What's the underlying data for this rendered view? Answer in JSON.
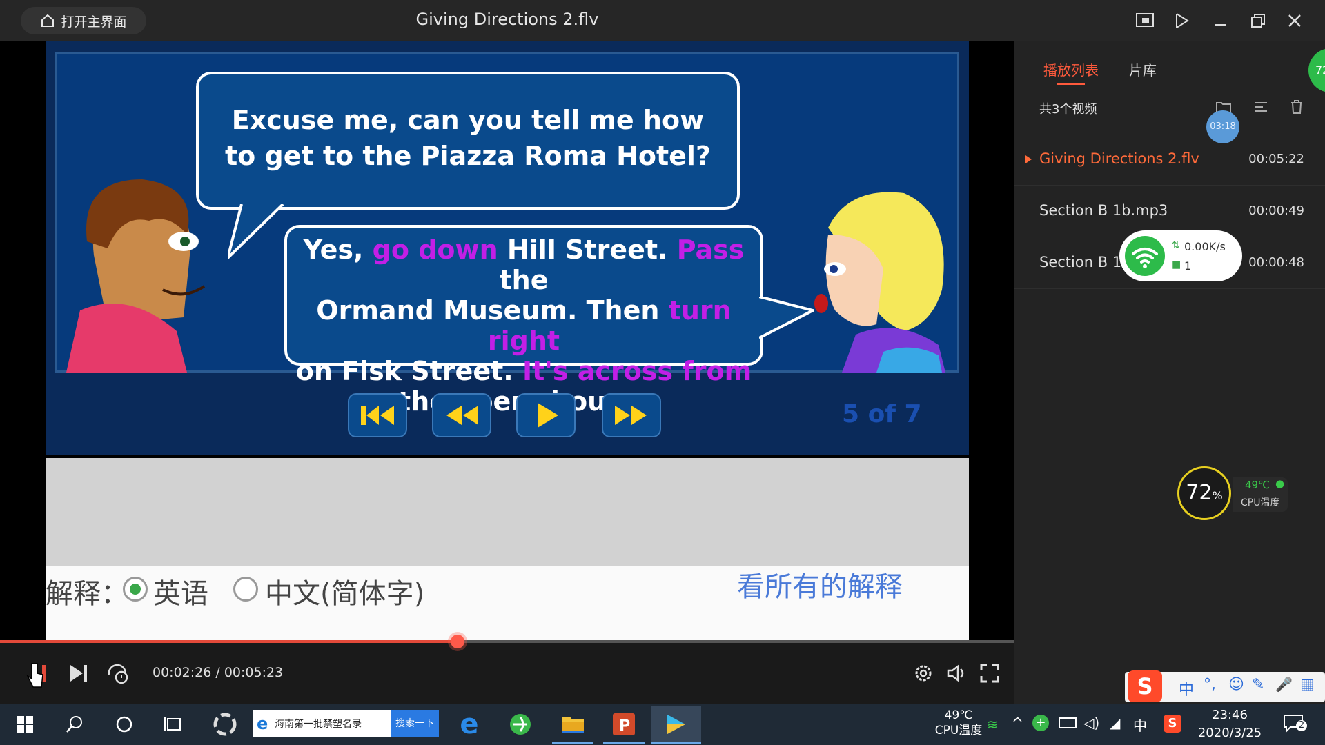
{
  "window": {
    "title": "Giving Directions 2.flv",
    "home_button": "打开主界面"
  },
  "video": {
    "bubble1_line1": "Excuse me, can you tell me how",
    "bubble1_line2": "to get to the Piazza Roma Hotel?",
    "b2_yes": "Yes,",
    "b2_go_down": "go down",
    "b2_hill": "Hill Street.",
    "b2_pass": "Pass",
    "b2_the": "the",
    "b2_ormand": "Ormand Museum. Then",
    "b2_turn_right": "turn right",
    "b2_on_fisk": "on Fisk Street.",
    "b2_across": "It's across from",
    "b2_opera": "the opera house.",
    "slide_counter": "5 of 7",
    "explain_label": "解释：",
    "option_english": "英语",
    "option_chinese": "中文(简体字)",
    "see_all": "看所有的解释"
  },
  "player": {
    "time_display": "00:02:26 / 00:05:23",
    "progress_fraction": 0.451
  },
  "sidebar": {
    "tabs": [
      "播放列表",
      "片库"
    ],
    "active_tab": "播放列表",
    "count_label": "共3个视频",
    "bubble_time": "03:18",
    "top_badge": "72",
    "playlist": [
      {
        "name": "Giving Directions 2.flv",
        "duration": "00:05:22",
        "active": true
      },
      {
        "name": "Section B 1b.mp3",
        "duration": "00:00:49",
        "active": false
      },
      {
        "name": "Section B 1",
        "duration": "00:00:48",
        "active": false
      }
    ]
  },
  "net_widget": {
    "speed": "0.00K/s",
    "count": "1"
  },
  "cpu_widget": {
    "percent": "72",
    "percent_unit": "%",
    "temp": "49℃",
    "label": "CPU温度"
  },
  "ime_bar": {
    "items": [
      "中",
      "°,",
      "☺",
      "✎",
      "🎤",
      "▦"
    ]
  },
  "taskbar": {
    "search_text": "海南第一批禁塑名录",
    "search_button": "搜索一下",
    "cpu_temp": "49℃",
    "cpu_label": "CPU温度",
    "ime": "中",
    "time": "23:46",
    "date": "2020/3/25",
    "notification_count": "2"
  },
  "colors": {
    "accent": "#ff5a3c",
    "active_item": "#ff6a3a",
    "highlight_text": "#c21fe6",
    "slide_bg": "#063a7c"
  }
}
